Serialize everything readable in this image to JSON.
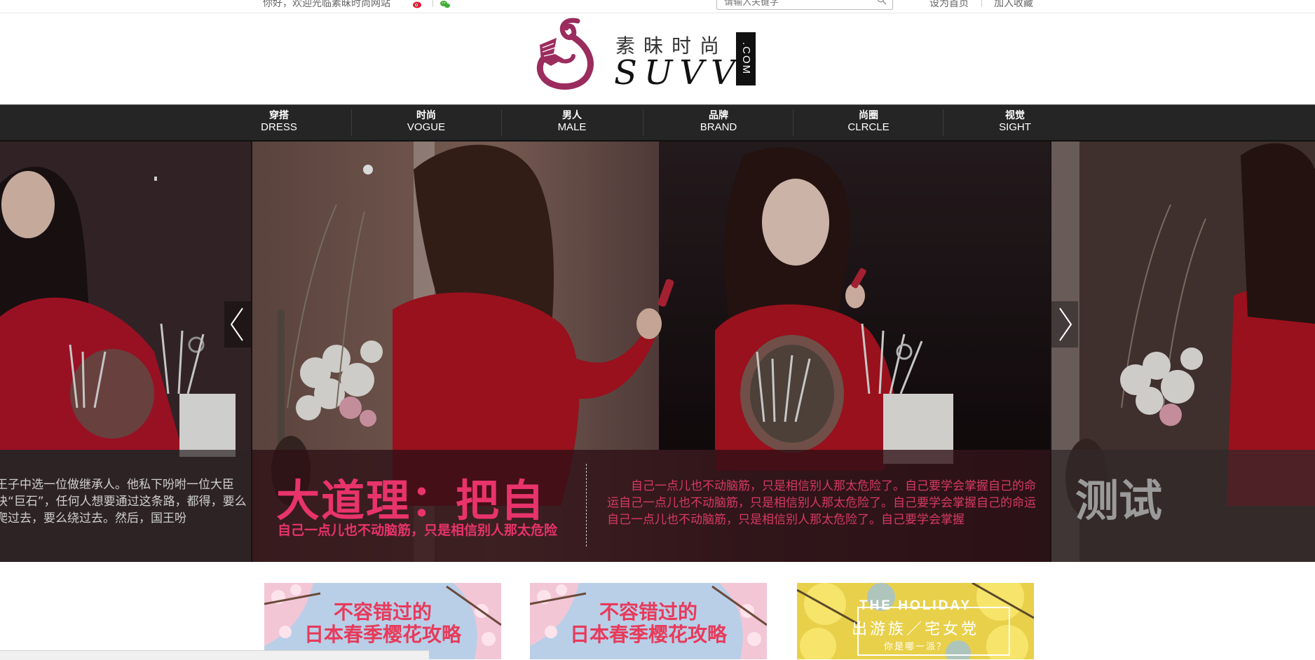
{
  "topbar": {
    "greeting": "你好，欢迎光临素昧时尚网站",
    "search_placeholder": "请输入关键字",
    "set_home": "设为首页",
    "add_favorite": "加入收藏"
  },
  "logo": {
    "cn": "素昧时尚",
    "en": "SUVVI",
    "dotcom": ".COM"
  },
  "nav": {
    "items": [
      {
        "cn": "穿搭",
        "en": "DRESS"
      },
      {
        "cn": "时尚",
        "en": "VOGUE"
      },
      {
        "cn": "男人",
        "en": "MALE"
      },
      {
        "cn": "品牌",
        "en": "BRAND"
      },
      {
        "cn": "尚圈",
        "en": "CLRCLE"
      },
      {
        "cn": "视觉",
        "en": "SIGHT"
      }
    ]
  },
  "slider": {
    "left_caption": "王子中选一位做继承人。他私下吩咐一位大臣块“巨石”，任何人想要通过这条路，都得，要么爬过去，要么绕过去。然后，国王吩",
    "main": {
      "title": "大道理：把自",
      "subtitle": "自己一点儿也不动脑筋，只是相信别人那太危险",
      "description": "自己一点儿也不动脑筋，只是相信别人那太危险了。自己要学会掌握自己的命运自己一点儿也不动脑筋，只是相信别人那太危险了。自己要学会掌握自己的命运自己一点儿也不动脑筋，只是相信别人那太危险了。自己要学会掌握"
    },
    "right_title": "测试"
  },
  "thumbs": [
    {
      "line1": "不容错过的",
      "line2": "日本春季樱花攻略"
    },
    {
      "line1": "不容错过的",
      "line2": "日本春季樱花攻略"
    },
    {
      "title": "THE HOLIDAY",
      "sub": "出游族／宅女党",
      "question": "你是哪一派？"
    }
  ],
  "colors": {
    "accent": "#e8336b",
    "nav_bg": "#252525",
    "logo_magenta": "#9b2c5e"
  }
}
